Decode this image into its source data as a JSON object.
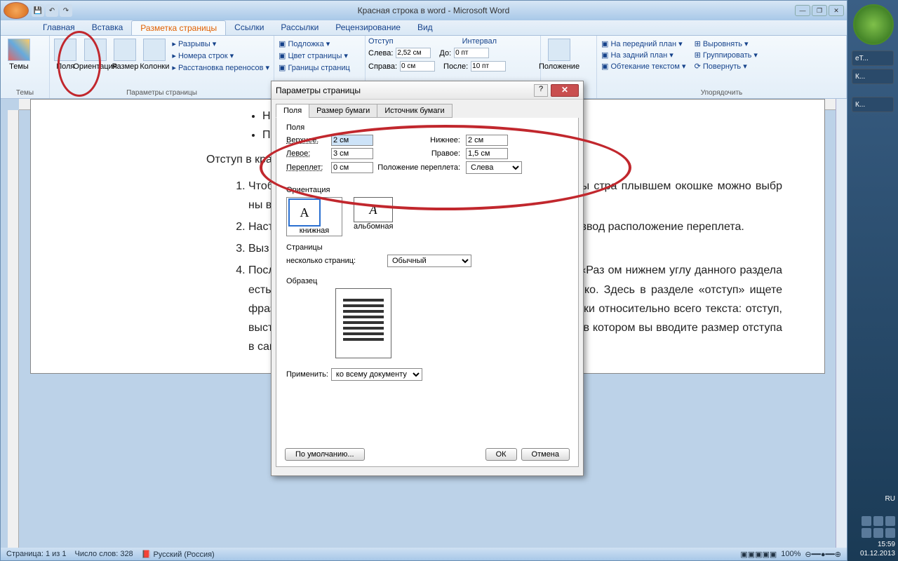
{
  "title": "Красная строка в word - Microsoft Word",
  "qat": [
    "💾",
    "↶",
    "↷"
  ],
  "win_controls": [
    "—",
    "❐",
    "✕"
  ],
  "ribbon_tabs": [
    "Главная",
    "Вставка",
    "Разметка страницы",
    "Ссылки",
    "Рассылки",
    "Рецензирование",
    "Вид"
  ],
  "active_tab_index": 2,
  "ribbon": {
    "themes": {
      "label": "Темы",
      "btn": "Темы"
    },
    "page_setup": {
      "label": "Параметры страницы",
      "margins": "Поля",
      "orientation": "Ориентация",
      "size": "Размер",
      "columns": "Колонки",
      "breaks": "Разрывы",
      "line_numbers": "Номера строк",
      "hyphenation": "Расстановка переносов"
    },
    "page_bg": {
      "watermark": "Подложка",
      "page_color": "Цвет страницы",
      "borders": "Границы страниц"
    },
    "indent": {
      "title": "Отступ",
      "left_lbl": "Слева:",
      "left_val": "2,52 см",
      "right_lbl": "Справа:",
      "right_val": "0 см"
    },
    "spacing": {
      "title": "Интервал",
      "before_lbl": "До:",
      "before_val": "0 пт",
      "after_lbl": "После:",
      "after_val": "10 пт"
    },
    "position": "Положение",
    "arrange": {
      "label": "Упорядочить",
      "front": "На передний план",
      "back": "На задний план",
      "wrap": "Обтекание текстом",
      "align": "Выровнять",
      "group": "Группировать",
      "rotate": "Повернуть"
    }
  },
  "doc": {
    "bullets": [
      "Ниж",
      "Прав"
    ],
    "para": "Отступ в кра                                                                                                       1,7 см.",
    "items": [
      "Чтоб                                                                                                отрыть вкладку «Разметка стра                                                                                              ите в раздел «Параметры стра                                                                                              плывшем окошке можно выбр                                                                                              ны вам не подходят, то мож",
      "Наст                                                                                               » кликаете иконку «поля», дале                                                                                               вшемся диалоговом окне ввод                                                                                               расположение переплета.",
      "Выз                                                                                                полей, можно нажав на мале                                                                                                раметры страницы».",
      "Посл                                                                                                тступов от края страницы мож                                                                                              оки. Заходите на вкладку «Раз                                                                                               ом нижнем углу данного раздела есть маленькая стрелочка. Кликаете по ней. Всплывает окошко. Здесь в разделе «отступ» ищете фразу «первая строка». Здесь можно выбрать положение строки относительно всего текста: отступ, выступ, или отсутствие изменений. Далее справа есть окошко, в котором вы вводите размер отступа в сантиметрах."
    ]
  },
  "dialog": {
    "title": "Параметры страницы",
    "tabs": [
      "Поля",
      "Размер бумаги",
      "Источник бумаги"
    ],
    "margins_legend": "Поля",
    "top_lbl": "Верхнее:",
    "top_val": "2 см",
    "bottom_lbl": "Нижнее:",
    "bottom_val": "2 см",
    "left_lbl": "Левое:",
    "left_val": "3 см",
    "right_lbl": "Правое:",
    "right_val": "1,5 см",
    "gutter_lbl": "Переплет:",
    "gutter_val": "0 см",
    "gutter_pos_lbl": "Положение переплета:",
    "gutter_pos_val": "Слева",
    "orientation_legend": "Ориентация",
    "portrait": "книжная",
    "landscape": "альбомная",
    "pages_legend": "Страницы",
    "multi_lbl": "несколько страниц:",
    "multi_val": "Обычный",
    "preview_legend": "Образец",
    "apply_lbl": "Применить:",
    "apply_val": "ко всему документу",
    "default_btn": "По умолчанию...",
    "ok": "ОК",
    "cancel": "Отмена"
  },
  "status": {
    "page": "Страница: 1 из 1",
    "words": "Число слов: 328",
    "lang": "Русский (Россия)",
    "zoom": "100%"
  },
  "tray": {
    "lang": "RU",
    "time": "15:59",
    "date": "01.12.2013"
  },
  "side_labels": [
    "еТ...",
    "К...",
    "К..."
  ]
}
